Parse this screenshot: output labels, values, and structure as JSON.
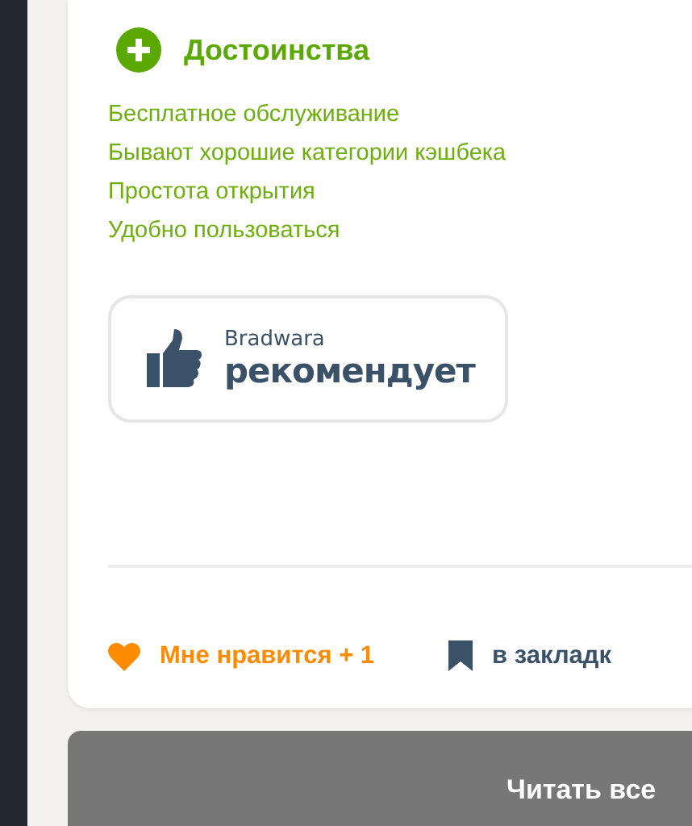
{
  "pros": {
    "title": "Достоинства",
    "items": [
      "Бесплатное обслуживание",
      "Бывают хорошие категории кэшбека",
      "Простота открытия",
      "Удобно пользоваться"
    ]
  },
  "recommend": {
    "brand": "Bradwara",
    "text": "рекомендует"
  },
  "actions": {
    "like": "Мне нравится + 1",
    "bookmark": "в закладк"
  },
  "read_all_button": "Читать все"
}
